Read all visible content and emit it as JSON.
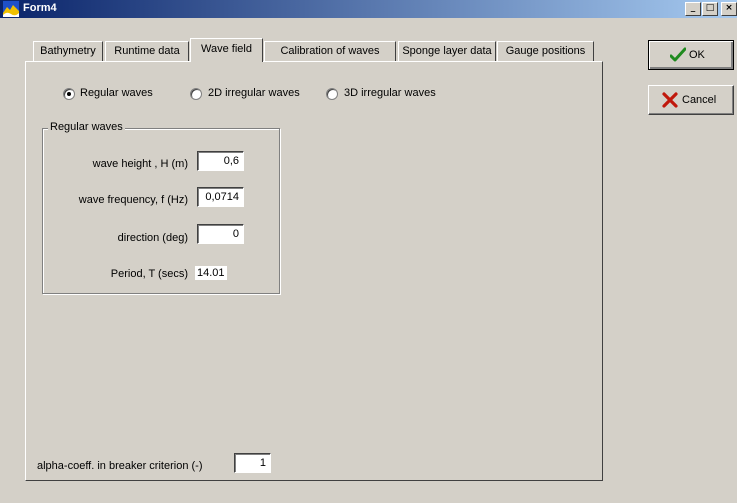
{
  "window": {
    "title": "Form4",
    "minimize_label": "_",
    "maximize_label": "□",
    "close_label": "×"
  },
  "tabs": [
    {
      "label": "Bathymetry"
    },
    {
      "label": "Runtime data"
    },
    {
      "label": "Wave field",
      "active": true
    },
    {
      "label": "Calibration of waves"
    },
    {
      "label": "Sponge layer data"
    },
    {
      "label": "Gauge positions"
    }
  ],
  "wave_type": {
    "options": [
      {
        "label": "Regular waves",
        "selected": true
      },
      {
        "label": "2D irregular waves",
        "selected": false
      },
      {
        "label": "3D irregular waves",
        "selected": false
      }
    ]
  },
  "regular_waves": {
    "group_title": "Regular waves",
    "wave_height_label": "wave height , H (m)",
    "wave_height_value": "0,6",
    "wave_frequency_label": "wave frequency, f (Hz)",
    "wave_frequency_value": "0,0714",
    "direction_label": "direction (deg)",
    "direction_value": "0",
    "period_label": "Period, T (secs)",
    "period_value": "14.01"
  },
  "breaker": {
    "label": "alpha-coeff. in breaker criterion (-)",
    "value": "1"
  },
  "buttons": {
    "ok_label": "OK",
    "cancel_label": "Cancel"
  },
  "colors": {
    "titlebar_start": "#0a246a",
    "titlebar_end": "#a6caf0",
    "face": "#d4d0c8",
    "ok_check": "#1f8a1f",
    "cancel_x": "#c0180c"
  }
}
